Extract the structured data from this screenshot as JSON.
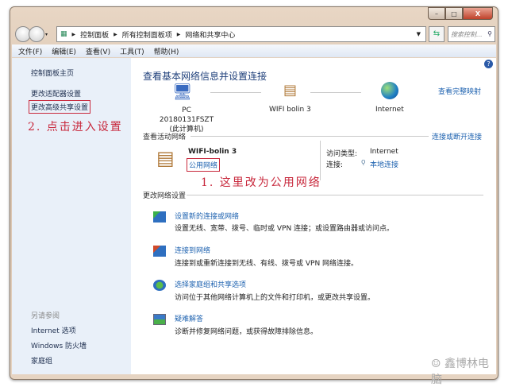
{
  "window": {
    "controls": [
      "–",
      "□",
      "X"
    ]
  },
  "address": {
    "crumbs": [
      "控制面板",
      "所有控制面板项",
      "网络和共享中心"
    ],
    "search_placeholder": "搜索控制..."
  },
  "menu": [
    "文件(F)",
    "编辑(E)",
    "查看(V)",
    "工具(T)",
    "帮助(H)"
  ],
  "sidebar": {
    "home": "控制面板主页",
    "adapter": "更改适配器设置",
    "advanced": "更改高级共享设置",
    "annotation": "2. 点击进入设置",
    "see_also": "另请参阅",
    "links": [
      "Internet 选项",
      "Windows 防火墙",
      "家庭组"
    ]
  },
  "main": {
    "heading": "查看基本网络信息并设置连接",
    "full_map": "查看完整映射",
    "map": {
      "pc": "PC 20180131FSZT",
      "pc_sub": "(此计算机)",
      "network": "WIFI bolin  3",
      "internet": "Internet"
    },
    "active_title": "查看活动网络",
    "connect_link": "连接或断开连接",
    "active": {
      "name": "WIFI-bolin  3",
      "type": "公用网络",
      "access_label": "访问类型:",
      "access_value": "Internet",
      "conn_label": "连接:",
      "conn_value": "本地连接"
    },
    "annotation": "1. 这里改为公用网络",
    "change_title": "更改网络设置",
    "tasks": [
      {
        "title": "设置新的连接或网络",
        "desc": "设置无线、宽带、拨号、临时或 VPN 连接；或设置路由器或访问点。"
      },
      {
        "title": "连接到网络",
        "desc": "连接到或重新连接到无线、有线、拨号或 VPN 网络连接。"
      },
      {
        "title": "选择家庭组和共享选项",
        "desc": "访问位于其他网络计算机上的文件和打印机，或更改共享设置。"
      },
      {
        "title": "疑难解答",
        "desc": "诊断并修复网络问题，或获得故障排除信息。"
      }
    ],
    "watermark": "鑫博林电脑"
  }
}
